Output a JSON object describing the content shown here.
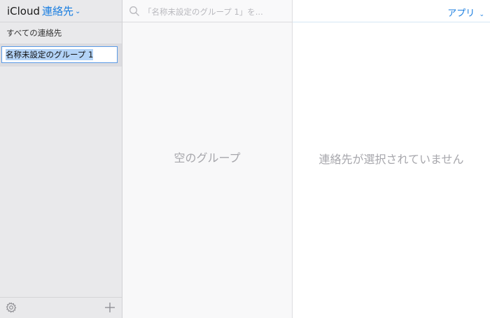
{
  "header": {
    "brand": "iCloud",
    "app_name": "連絡先",
    "app_switcher_label": "アプリ"
  },
  "sidebar": {
    "all_contacts_label": "すべての連絡先",
    "group_name_value": "名称未設定のグループ 1"
  },
  "list": {
    "search_placeholder": "「名称未設定のグループ 1」を...",
    "empty_message": "空のグループ"
  },
  "detail": {
    "empty_message": "連絡先が選択されていません"
  },
  "icons": {
    "settings": "gear-icon",
    "add": "plus-icon",
    "search": "search-icon",
    "dropdown": "chevron-down-icon"
  },
  "colors": {
    "accent": "#1c7fe0",
    "sidebar_bg": "#e9e9eb",
    "muted_text": "#a7a7ac"
  }
}
